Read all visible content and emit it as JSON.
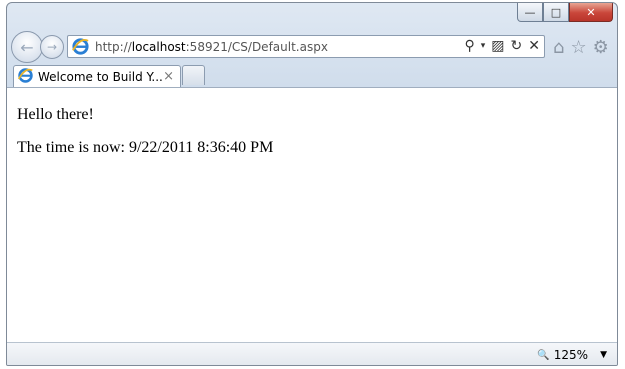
{
  "window": {
    "minimize_glyph": "—",
    "maximize_glyph": "□",
    "close_glyph": "✕"
  },
  "nav": {
    "back_glyph": "←",
    "forward_glyph": "→"
  },
  "address": {
    "url_prefix": "http://",
    "url_host": "localhost",
    "url_rest": ":58921/CS/Default.aspx",
    "search_glyph": "⚲",
    "dropdown_glyph": "▾",
    "compat_glyph": "▨",
    "refresh_glyph": "↻",
    "stop_glyph": "✕"
  },
  "toolbar_icons": {
    "home_glyph": "⌂",
    "favorites_glyph": "☆",
    "tools_glyph": "⚙"
  },
  "tab": {
    "label": "Welcome to Build Y...",
    "close_glyph": "×"
  },
  "content": {
    "line1": "Hello there!",
    "line2": "The time is now: 9/22/2011 8:36:40 PM"
  },
  "status": {
    "zoom": "125%",
    "zoom_icon": "🔍",
    "dropdown_glyph": "▼"
  },
  "colors": {
    "chrome": "#dfe8f3",
    "close_button": "#c9463a",
    "ie_blue": "#2a7fd4"
  }
}
